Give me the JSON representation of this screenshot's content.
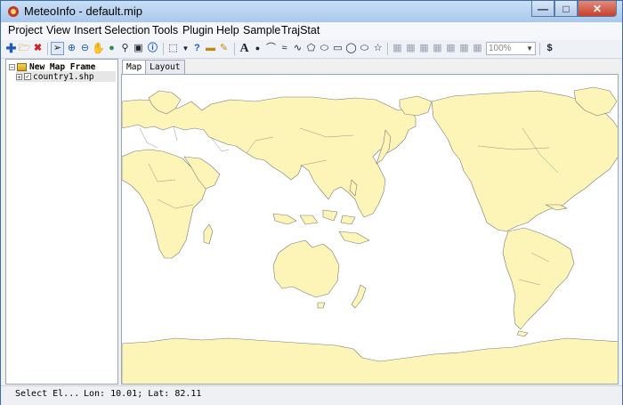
{
  "window": {
    "title": "MeteoInfo - default.mip"
  },
  "menubar": [
    "Project",
    "View",
    "Insert",
    "Selection",
    "Tools",
    "Plugin",
    "Help",
    "Sample",
    "TrajStat"
  ],
  "toolbar": {
    "zoom_value": "100%"
  },
  "layers": {
    "frame_label": "New Map Frame",
    "layer_label": "country1.shp",
    "layer_checked": true
  },
  "tabs": [
    "Map",
    "Layout"
  ],
  "status": {
    "text": "Select El...",
    "coords": "Lon: 10.01; Lat: 82.11"
  },
  "colors": {
    "land": "#fdf4b8",
    "coast": "#7a7a7a",
    "ocean": "#ffffff"
  }
}
